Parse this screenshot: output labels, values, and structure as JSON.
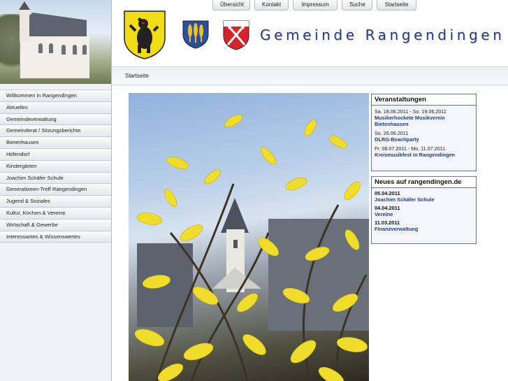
{
  "top_nav": [
    "Übersicht",
    "Kontakt",
    "Impressum",
    "Suche",
    "Startseite"
  ],
  "site_title": "Gemeinde Rangendingen",
  "breadcrumb": "Startseite",
  "sidebar": {
    "items": [
      "Willkommen in Rangendingen",
      "Aktuelles",
      "Gemeindeverwaltung",
      "Gemeinderat / Sitzungsberichte",
      "Bietenhausen",
      "Höfendorf",
      "Kindergärten",
      "Joachim Schäfer Schule",
      "Generationen-Treff Rangendingen",
      "Jugend & Soziales",
      "Kultur, Kirchen & Vereine",
      "Wirtschaft & Gewerbe",
      "Interessantes & Wissenswertes"
    ]
  },
  "events": {
    "title": "Veranstaltungen",
    "items": [
      {
        "date": "Sa. 18.06.2011 - So. 19.06.2011",
        "title": "Musikerhockete Musikverein Bietenhausen"
      },
      {
        "date": "So. 26.06.2011",
        "title": "DLRG-Beachparty"
      },
      {
        "date": "Fr. 08.07.2011 - Mo. 11.07.2011",
        "title": "Kreismusikfest in Rangendingen"
      }
    ]
  },
  "news": {
    "title": "Neues auf rangendingen.de",
    "items": [
      {
        "date": "05.04.2011",
        "title": "Joachim Schäfer Schule"
      },
      {
        "date": "04.04.2011",
        "title": "Vereine"
      },
      {
        "date": "11.03.2011",
        "title": "Finanzverwaltung"
      }
    ]
  },
  "colors": {
    "title_blue": "#2b3b86",
    "link_blue": "#1f3d8a",
    "box_border": "#6c7598"
  }
}
